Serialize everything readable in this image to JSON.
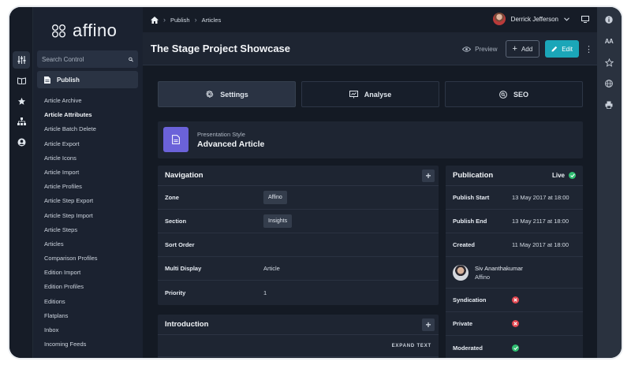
{
  "app": {
    "logo_text": "affino"
  },
  "sidebar": {
    "search_placeholder": "Search Control",
    "section": "Publish",
    "items": [
      "Article Archive",
      "Article Attributes",
      "Article Batch Delete",
      "Article Export",
      "Article Icons",
      "Article Import",
      "Article Profiles",
      "Article Step Export",
      "Article Step Import",
      "Article Steps",
      "Articles",
      "Comparison Profiles",
      "Edition Import",
      "Edition Profiles",
      "Editions",
      "Flatplans",
      "Inbox",
      "Incoming Feeds"
    ]
  },
  "breadcrumb": {
    "items": [
      "Publish",
      "Articles"
    ]
  },
  "user": {
    "name": "Derrick Jefferson"
  },
  "header": {
    "title": "The Stage Project Showcase",
    "preview_label": "Preview",
    "add_label": "Add",
    "edit_label": "Edit"
  },
  "tabs": [
    {
      "label": "Settings",
      "icon": "gear-icon",
      "active": true
    },
    {
      "label": "Analyse",
      "icon": "chart-board-icon",
      "active": false
    },
    {
      "label": "SEO",
      "icon": "seo-search-icon",
      "active": false
    }
  ],
  "presentation": {
    "label": "Presentation Style",
    "value": "Advanced Article"
  },
  "navigation": {
    "title": "Navigation",
    "rows": [
      {
        "key": "Zone",
        "value": "Affino",
        "chip": true
      },
      {
        "key": "Section",
        "value": "Insights",
        "chip": true
      },
      {
        "key": "Sort Order",
        "value": "",
        "chip": false
      },
      {
        "key": "Multi Display",
        "value": "Article",
        "chip": false
      },
      {
        "key": "Priority",
        "value": "1",
        "chip": false
      }
    ]
  },
  "introduction": {
    "title": "Introduction",
    "expand_label": "EXPAND TEXT"
  },
  "publication": {
    "title": "Publication",
    "status": "Live",
    "status_color": "#2fbf71",
    "rows": [
      {
        "key": "Publish Start",
        "value": "13 May 2017 at 18:00"
      },
      {
        "key": "Publish End",
        "value": "13 May 2117 at 18:00"
      },
      {
        "key": "Created",
        "value": "11 May 2017 at 18:00"
      }
    ],
    "author": {
      "name": "Siv Ananthakumar",
      "org": "Affino"
    },
    "flags": [
      {
        "key": "Syndication",
        "state": "off"
      },
      {
        "key": "Private",
        "state": "off"
      },
      {
        "key": "Moderated",
        "state": "on"
      }
    ]
  }
}
